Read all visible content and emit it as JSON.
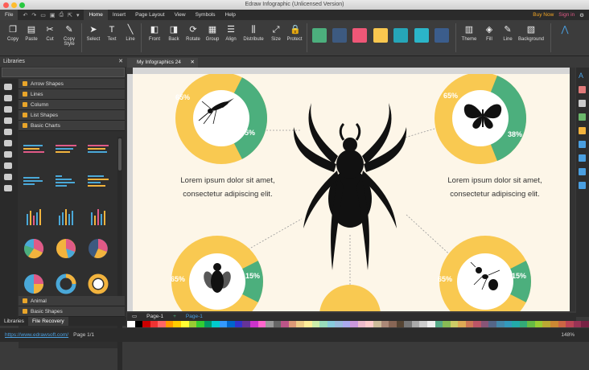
{
  "window": {
    "title": "Edraw Infographic (Unlicensed Version)"
  },
  "menu": {
    "file": "File",
    "items": [
      "Home",
      "Insert",
      "Page Layout",
      "View",
      "Symbols",
      "Help"
    ],
    "active": "Home",
    "buy_now": "Buy Now",
    "sign_in": "Sign in"
  },
  "ribbon": {
    "buttons": [
      {
        "label": "Copy",
        "icon": "copy-icon"
      },
      {
        "label": "Paste",
        "icon": "paste-icon"
      },
      {
        "label": "Cut",
        "icon": "cut-icon"
      },
      {
        "label": "Copy Style",
        "icon": "format-painter-icon"
      },
      {
        "label": "Select",
        "icon": "pointer-icon"
      },
      {
        "label": "Text",
        "icon": "text-icon"
      },
      {
        "label": "Line",
        "icon": "line-icon"
      },
      {
        "label": "Front",
        "icon": "bring-front-icon"
      },
      {
        "label": "Back",
        "icon": "send-back-icon"
      },
      {
        "label": "Rotate",
        "icon": "rotate-icon"
      },
      {
        "label": "Group",
        "icon": "group-icon"
      },
      {
        "label": "Align",
        "icon": "align-icon"
      },
      {
        "label": "Distribute",
        "icon": "distribute-icon"
      },
      {
        "label": "Size",
        "icon": "size-icon"
      },
      {
        "label": "Protect",
        "icon": "lock-icon"
      },
      {
        "label": "Theme",
        "icon": "theme-icon"
      },
      {
        "label": "Fill",
        "icon": "fill-icon"
      },
      {
        "label": "Line",
        "icon": "line-style-icon"
      },
      {
        "label": "Background",
        "icon": "background-icon"
      }
    ],
    "theme_colors": [
      "#4caf7d",
      "#3d5a80",
      "#ef5777",
      "#f9c74f",
      "#26a6b8",
      "#2bb5c8",
      "#3b5d8c"
    ]
  },
  "sidebar": {
    "title": "Libraries",
    "categories": [
      "Arrow Shapes",
      "Lines",
      "Column",
      "List Shapes",
      "Basic Charts"
    ],
    "bottom_categories": [
      "Animal",
      "Basic Shapes"
    ],
    "tabs": [
      "Libraries",
      "File Recovery"
    ]
  },
  "document": {
    "tab": "My Infographics 24"
  },
  "infographic": {
    "colors": {
      "yellow": "#f9c951",
      "green": "#4caf7d",
      "dark": "#111111",
      "text": "#333333"
    },
    "donuts": [
      {
        "id": "mosquito",
        "left_pct": "65%",
        "right_pct": "35%",
        "value": 0.35
      },
      {
        "id": "butterfly",
        "left_pct": "65%",
        "right_pct": "38%",
        "value": 0.38
      },
      {
        "id": "fly",
        "left_pct": "65%",
        "right_pct": "15%",
        "value": 0.15
      },
      {
        "id": "ant",
        "left_pct": "65%",
        "right_pct": "15%",
        "value": 0.15
      }
    ],
    "text_left": [
      "Lorem ipsum dolor sit amet,",
      "consectetur adipiscing elit."
    ],
    "text_right": [
      "Lorem ipsum dolor sit amet,",
      "consectetur adipiscing elit."
    ]
  },
  "pages": {
    "current": "Page-1",
    "tab": "Page-1"
  },
  "status": {
    "url": "https://www.edrawsoft.com/",
    "page": "Page 1/1",
    "zoom": "148%"
  }
}
